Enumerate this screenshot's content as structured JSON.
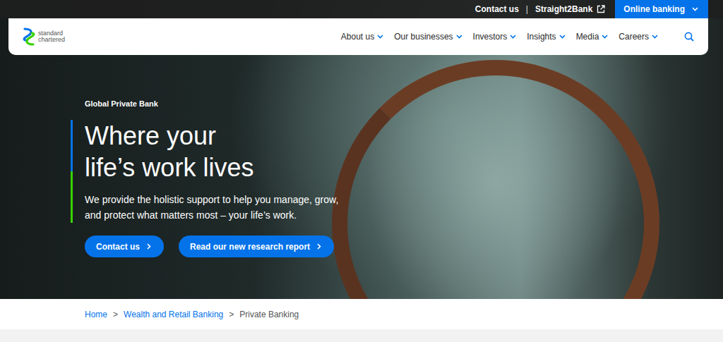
{
  "top_bar": {
    "links": [
      "Contact us",
      "Straight2Bank"
    ],
    "separator": "|",
    "online_banking": "Online banking"
  },
  "nav": {
    "logo_lines": [
      "standard",
      "chartered"
    ],
    "items": [
      "About us",
      "Our businesses",
      "Investors",
      "Insights",
      "Media",
      "Careers"
    ]
  },
  "hero": {
    "eyebrow": "Global Private Bank",
    "title_lines": [
      "Where your",
      "life’s work lives"
    ],
    "description_lines": [
      "We provide the holistic support to help you manage, grow,",
      "and protect what matters most – your life’s work."
    ],
    "buttons": [
      "Contact us",
      "Read our new research report"
    ]
  },
  "breadcrumb": {
    "separator": ">",
    "items": [
      {
        "label": "Home",
        "current": false
      },
      {
        "label": "Wealth and Retail Banking",
        "current": false
      },
      {
        "label": "Private Banking",
        "current": true
      }
    ]
  }
}
